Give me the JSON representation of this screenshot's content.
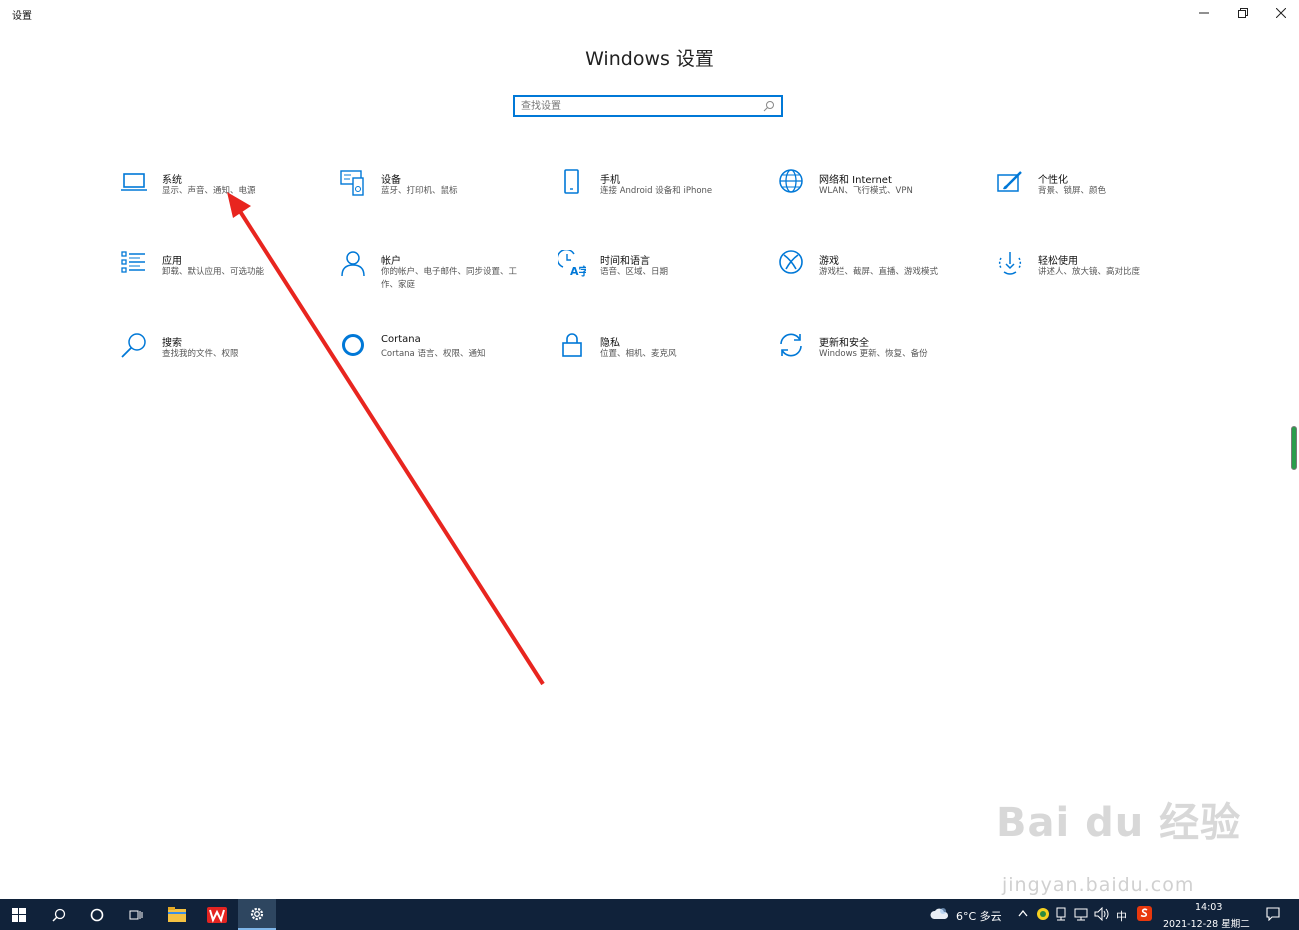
{
  "window": {
    "title": "设置",
    "minimize": "—",
    "maximize": "❐",
    "close": "✕"
  },
  "page_title": "Windows 设置",
  "search": {
    "placeholder": "查找设置"
  },
  "tiles": [
    {
      "name": "系统",
      "desc": "显示、声音、通知、电源",
      "icon": "laptop-icon"
    },
    {
      "name": "设备",
      "desc": "蓝牙、打印机、鼠标",
      "icon": "keyboard-device-icon"
    },
    {
      "name": "手机",
      "desc": "连接 Android 设备和 iPhone",
      "icon": "phone-icon"
    },
    {
      "name": "网络和 Internet",
      "desc": "WLAN、飞行模式、VPN",
      "icon": "globe-icon"
    },
    {
      "name": "个性化",
      "desc": "背景、锁屏、颜色",
      "icon": "paint-brush-icon"
    },
    {
      "name": "应用",
      "desc": "卸载、默认应用、可选功能",
      "icon": "app-list-icon"
    },
    {
      "name": "帐户",
      "desc": "你的帐户、电子邮件、同步设置、工作、家庭",
      "icon": "person-icon"
    },
    {
      "name": "时间和语言",
      "desc": "语音、区域、日期",
      "icon": "time-language-icon"
    },
    {
      "name": "游戏",
      "desc": "游戏栏、截屏、直播、游戏模式",
      "icon": "xbox-icon"
    },
    {
      "name": "轻松使用",
      "desc": "讲述人、放大镜、高对比度",
      "icon": "ease-of-access-icon"
    },
    {
      "name": "搜索",
      "desc": "查找我的文件、权限",
      "icon": "search-icon"
    },
    {
      "name": "Cortana",
      "desc": "Cortana 语言、权限、通知",
      "icon": "cortana-icon"
    },
    {
      "name": "隐私",
      "desc": "位置、相机、麦克风",
      "icon": "lock-icon"
    },
    {
      "name": "更新和安全",
      "desc": "Windows 更新、恢复、备份",
      "icon": "sync-icon"
    }
  ],
  "watermark": {
    "main": "Bai du 经验",
    "sub": "jingyan.baidu.com"
  },
  "taskbar": {
    "weather": "6°C 多云",
    "ime": "中",
    "time": "14:03",
    "date": "2021-12-28 星期二"
  },
  "colors": {
    "accent": "#0078d7",
    "annotation_arrow": "#e8251f",
    "taskbar": "#10223a"
  }
}
